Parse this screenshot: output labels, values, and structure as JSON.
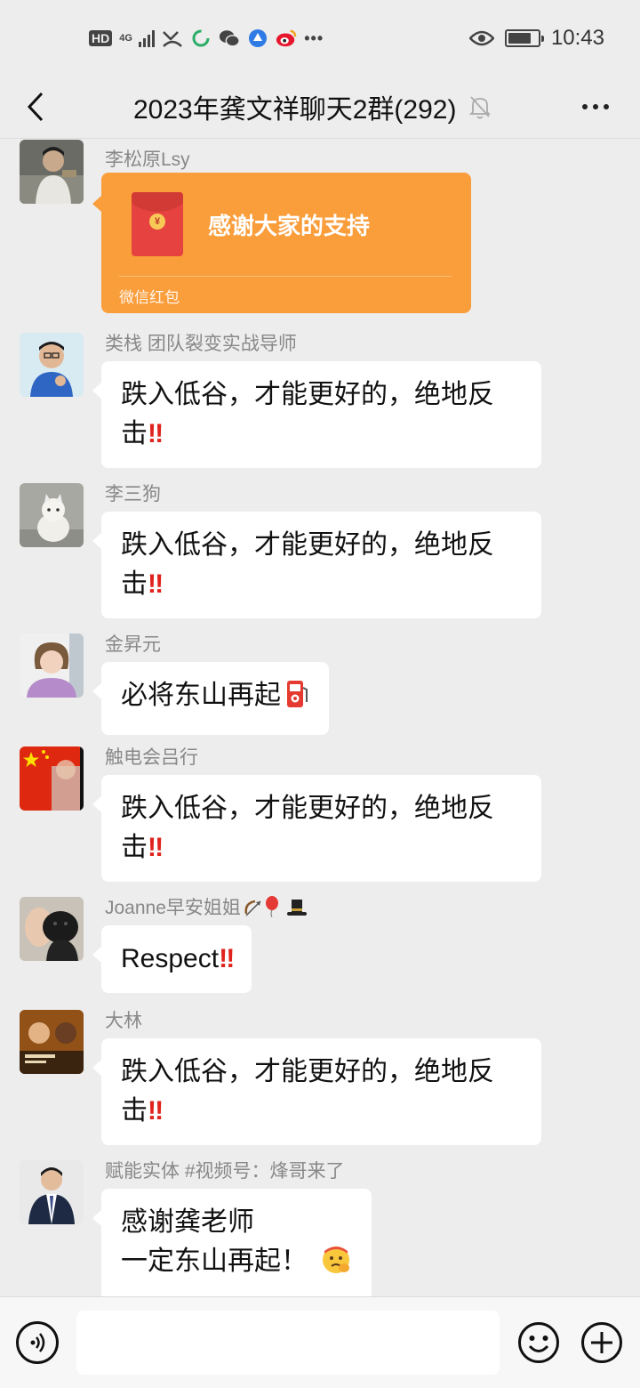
{
  "status_bar": {
    "hd": "HD",
    "network": "4G",
    "time": "10:43",
    "battery_level": 0.82
  },
  "header": {
    "title": "2023年龚文祥聊天2群(292)"
  },
  "messages": [
    {
      "sender": "李松原Lsy",
      "type": "red_packet",
      "greeting": "感谢大家的支持",
      "footer": "微信红包"
    },
    {
      "sender": "类栈 团队裂变实战导师",
      "line1": "跌入低谷，才能更好的，绝地反",
      "line2": "击",
      "emphasis": "‼"
    },
    {
      "sender": "李三狗",
      "line1": "跌入低谷，才能更好的，绝地反",
      "line2": "击",
      "emphasis": "‼"
    },
    {
      "sender": "金昇元",
      "text": "必将东山再起",
      "emoji": "fuel-pump"
    },
    {
      "sender": "触电会吕行",
      "line1": "跌入低谷，才能更好的，绝地反",
      "line2": "击",
      "emphasis": "‼"
    },
    {
      "sender": "Joanne早安姐姐",
      "sender_emojis": [
        "bow-and-arrow",
        "balloon",
        "top-hat"
      ],
      "text": "Respect",
      "emphasis": "‼"
    },
    {
      "sender": "大林",
      "line1": "跌入低谷，才能更好的，绝地反",
      "line2": "击",
      "emphasis": "‼"
    },
    {
      "sender": "赋能实体 #视频号：烽哥来了",
      "line1": "感谢龚老师",
      "line2": "一定东山再起！",
      "emoji": "salute-face"
    }
  ],
  "colors": {
    "background": "#EDEDED",
    "bubble": "#FFFFFF",
    "red_packet": "#FA9D3B",
    "emphasis": "#E0231C"
  }
}
